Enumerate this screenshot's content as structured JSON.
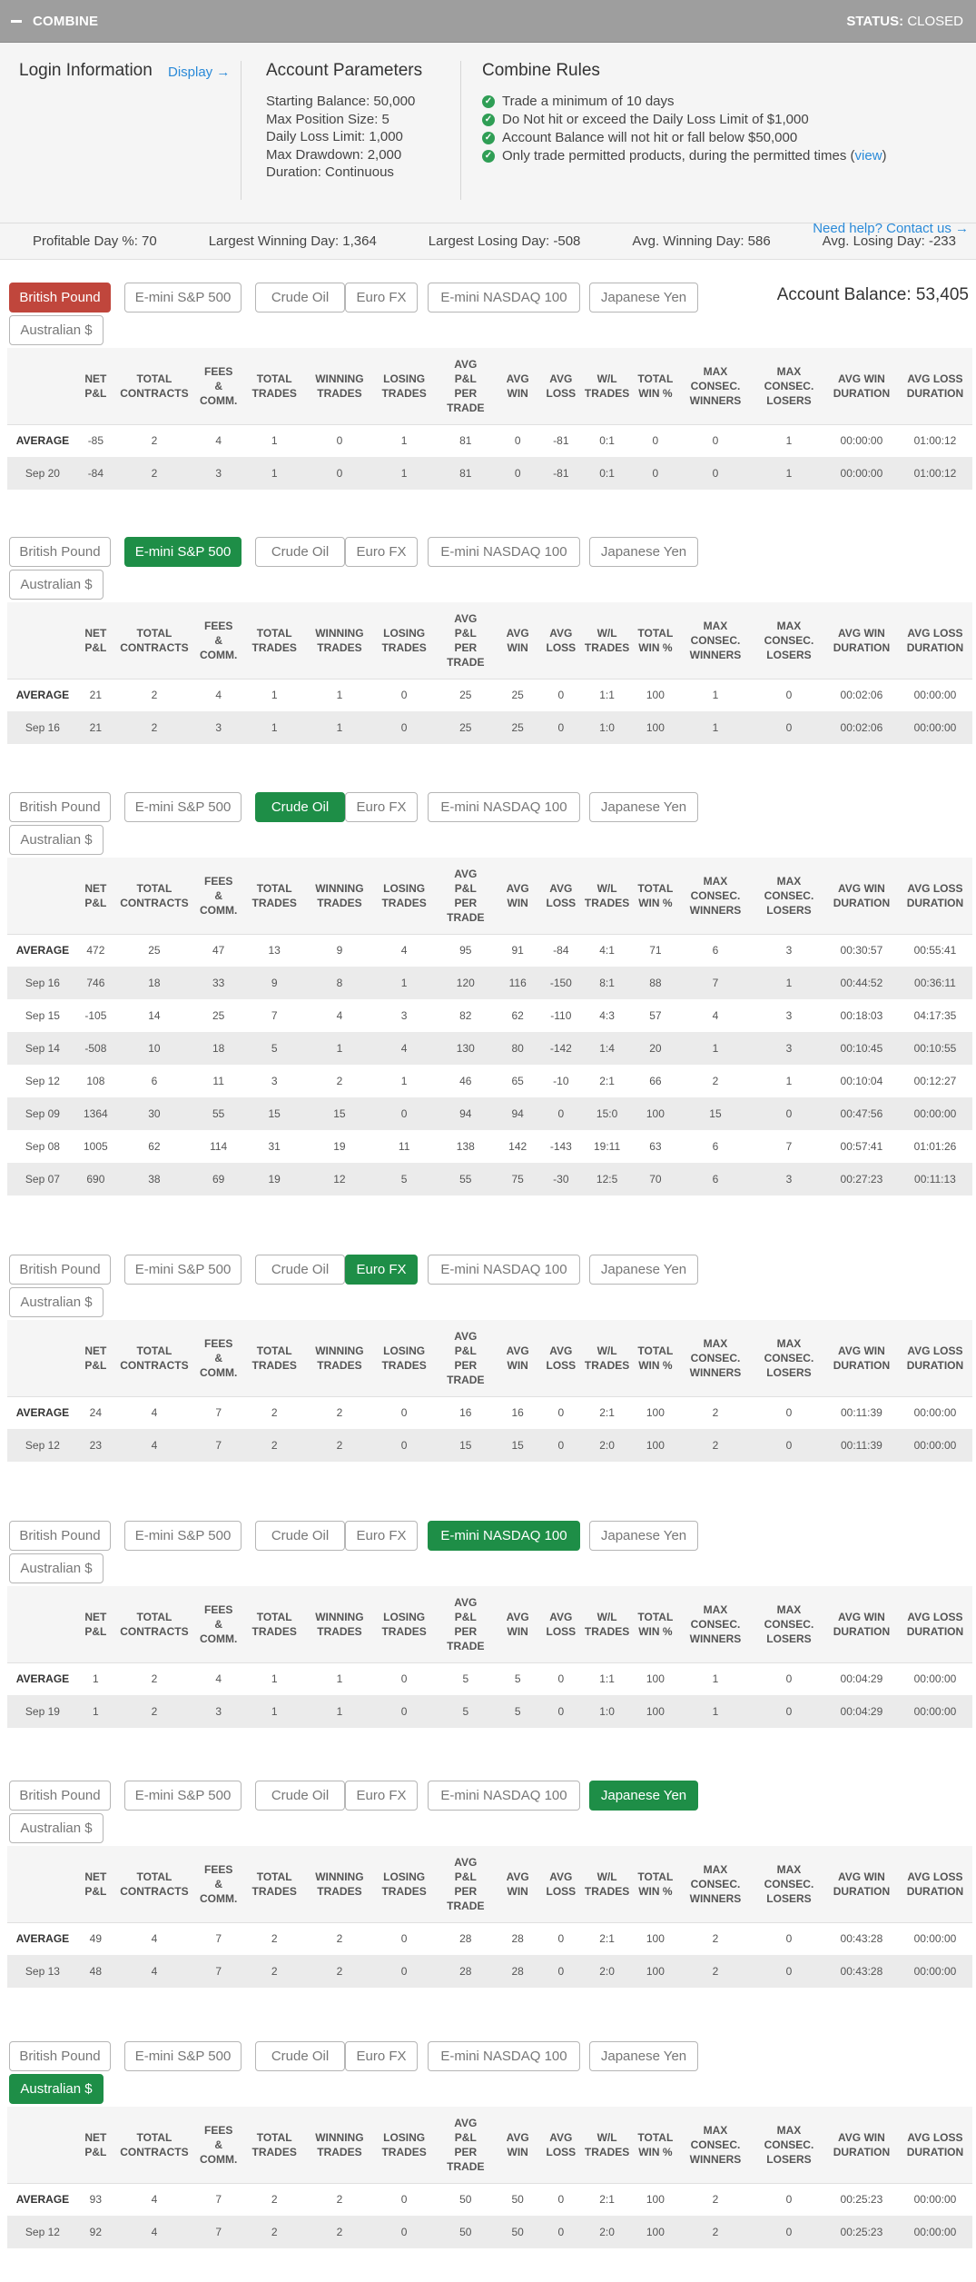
{
  "topbar": {
    "title": "COMBINE",
    "status_label": "STATUS:",
    "status_value": "CLOSED"
  },
  "login": {
    "title": "Login Information",
    "display_link": "Display →"
  },
  "account_parameters": {
    "title": "Account Parameters",
    "lines": [
      "Starting Balance: 50,000",
      "Max Position Size: 5",
      "Daily Loss Limit: 1,000",
      "Max Drawdown: 2,000",
      "Duration: Continuous"
    ]
  },
  "combine_rules": {
    "title": "Combine Rules",
    "rules": [
      "Trade a minimum of 10 days",
      "Do Not hit or exceed the Daily Loss Limit of $1,000",
      "Account Balance will not hit or fall below $50,000",
      "Only trade permitted products, during the permitted times ("
    ],
    "view_link": "view",
    "rule_close": ")",
    "help_link": "Need help? Contact us →"
  },
  "stats": [
    "Profitable Day %: 70",
    "Largest Winning Day: 1,364",
    "Largest Losing Day: -508",
    "Avg. Winning Day: 586",
    "Avg. Losing Day: -233"
  ],
  "products": [
    "British Pound",
    "E-mini S&P 500",
    "Crude Oil",
    "Euro FX",
    "E-mini NASDAQ 100",
    "Japanese Yen",
    "Australian $"
  ],
  "account_balance": "Account Balance: 53,405",
  "columns": [
    [
      "NET",
      "P&L"
    ],
    [
      "TOTAL",
      "CONTRACTS"
    ],
    [
      "FEES",
      "&",
      "COMM."
    ],
    [
      "TOTAL",
      "TRADES"
    ],
    [
      "WINNING",
      "TRADES"
    ],
    [
      "LOSING",
      "TRADES"
    ],
    [
      "AVG",
      "P&L",
      "PER",
      "TRADE"
    ],
    [
      "AVG",
      "WIN"
    ],
    [
      "AVG",
      "LOSS"
    ],
    [
      "W/L",
      "TRADES"
    ],
    [
      "TOTAL",
      "WIN %"
    ],
    [
      "MAX",
      "CONSEC.",
      "WINNERS"
    ],
    [
      "MAX",
      "CONSEC.",
      "LOSERS"
    ],
    [
      "AVG WIN",
      "DURATION"
    ],
    [
      "AVG LOSS",
      "DURATION"
    ]
  ],
  "sections": [
    {
      "active": 0,
      "rows": [
        [
          "AVERAGE",
          "-85",
          "2",
          "4",
          "1",
          "0",
          "1",
          "81",
          "0",
          "-81",
          "0:1",
          "0",
          "0",
          "1",
          "00:00:00",
          "01:00:12"
        ],
        [
          "Sep 20",
          "-84",
          "2",
          "3",
          "1",
          "0",
          "1",
          "81",
          "0",
          "-81",
          "0:1",
          "0",
          "0",
          "1",
          "00:00:00",
          "01:00:12"
        ]
      ]
    },
    {
      "active": 1,
      "rows": [
        [
          "AVERAGE",
          "21",
          "2",
          "4",
          "1",
          "1",
          "0",
          "25",
          "25",
          "0",
          "1:1",
          "100",
          "1",
          "0",
          "00:02:06",
          "00:00:00"
        ],
        [
          "Sep 16",
          "21",
          "2",
          "3",
          "1",
          "1",
          "0",
          "25",
          "25",
          "0",
          "1:0",
          "100",
          "1",
          "0",
          "00:02:06",
          "00:00:00"
        ]
      ]
    },
    {
      "active": 2,
      "rows": [
        [
          "AVERAGE",
          "472",
          "25",
          "47",
          "13",
          "9",
          "4",
          "95",
          "91",
          "-84",
          "4:1",
          "71",
          "6",
          "3",
          "00:30:57",
          "00:55:41"
        ],
        [
          "Sep 16",
          "746",
          "18",
          "33",
          "9",
          "8",
          "1",
          "120",
          "116",
          "-150",
          "8:1",
          "88",
          "7",
          "1",
          "00:44:52",
          "00:36:11"
        ],
        [
          "Sep 15",
          "-105",
          "14",
          "25",
          "7",
          "4",
          "3",
          "82",
          "62",
          "-110",
          "4:3",
          "57",
          "4",
          "3",
          "00:18:03",
          "04:17:35"
        ],
        [
          "Sep 14",
          "-508",
          "10",
          "18",
          "5",
          "1",
          "4",
          "130",
          "80",
          "-142",
          "1:4",
          "20",
          "1",
          "3",
          "00:10:45",
          "00:10:55"
        ],
        [
          "Sep 12",
          "108",
          "6",
          "11",
          "3",
          "2",
          "1",
          "46",
          "65",
          "-10",
          "2:1",
          "66",
          "2",
          "1",
          "00:10:04",
          "00:12:27"
        ],
        [
          "Sep 09",
          "1364",
          "30",
          "55",
          "15",
          "15",
          "0",
          "94",
          "94",
          "0",
          "15:0",
          "100",
          "15",
          "0",
          "00:47:56",
          "00:00:00"
        ],
        [
          "Sep 08",
          "1005",
          "62",
          "114",
          "31",
          "19",
          "11",
          "138",
          "142",
          "-143",
          "19:11",
          "63",
          "6",
          "7",
          "00:57:41",
          "01:01:26"
        ],
        [
          "Sep 07",
          "690",
          "38",
          "69",
          "19",
          "12",
          "5",
          "55",
          "75",
          "-30",
          "12:5",
          "70",
          "6",
          "3",
          "00:27:23",
          "00:11:13"
        ]
      ]
    },
    {
      "active": 3,
      "rows": [
        [
          "AVERAGE",
          "24",
          "4",
          "7",
          "2",
          "2",
          "0",
          "16",
          "16",
          "0",
          "2:1",
          "100",
          "2",
          "0",
          "00:11:39",
          "00:00:00"
        ],
        [
          "Sep 12",
          "23",
          "4",
          "7",
          "2",
          "2",
          "0",
          "15",
          "15",
          "0",
          "2:0",
          "100",
          "2",
          "0",
          "00:11:39",
          "00:00:00"
        ]
      ]
    },
    {
      "active": 4,
      "rows": [
        [
          "AVERAGE",
          "1",
          "2",
          "4",
          "1",
          "1",
          "0",
          "5",
          "5",
          "0",
          "1:1",
          "100",
          "1",
          "0",
          "00:04:29",
          "00:00:00"
        ],
        [
          "Sep 19",
          "1",
          "2",
          "3",
          "1",
          "1",
          "0",
          "5",
          "5",
          "0",
          "1:0",
          "100",
          "1",
          "0",
          "00:04:29",
          "00:00:00"
        ]
      ]
    },
    {
      "active": 5,
      "rows": [
        [
          "AVERAGE",
          "49",
          "4",
          "7",
          "2",
          "2",
          "0",
          "28",
          "28",
          "0",
          "2:1",
          "100",
          "2",
          "0",
          "00:43:28",
          "00:00:00"
        ],
        [
          "Sep 13",
          "48",
          "4",
          "7",
          "2",
          "2",
          "0",
          "28",
          "28",
          "0",
          "2:0",
          "100",
          "2",
          "0",
          "00:43:28",
          "00:00:00"
        ]
      ]
    },
    {
      "active": 6,
      "rows": [
        [
          "AVERAGE",
          "93",
          "4",
          "7",
          "2",
          "2",
          "0",
          "50",
          "50",
          "0",
          "2:1",
          "100",
          "2",
          "0",
          "00:25:23",
          "00:00:00"
        ],
        [
          "Sep 12",
          "92",
          "4",
          "7",
          "2",
          "2",
          "0",
          "50",
          "50",
          "0",
          "2:0",
          "100",
          "2",
          "0",
          "00:25:23",
          "00:00:00"
        ]
      ]
    }
  ]
}
